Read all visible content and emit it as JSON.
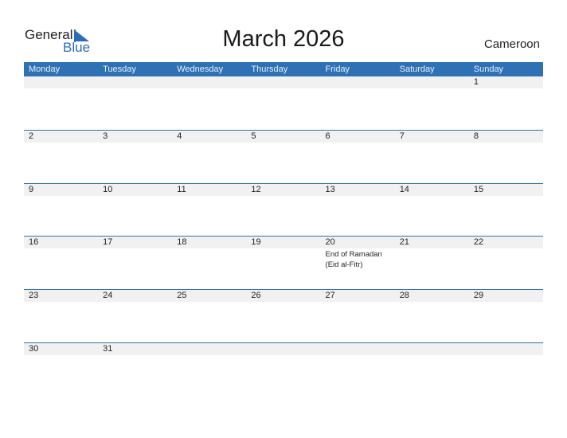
{
  "logo": {
    "text_general": "General",
    "text_blue": "Blue"
  },
  "title": "March 2026",
  "country": "Cameroon",
  "colors": {
    "accent": "#2e72b5",
    "shade": "#f1f1f1"
  },
  "weekdays": [
    "Monday",
    "Tuesday",
    "Wednesday",
    "Thursday",
    "Friday",
    "Saturday",
    "Sunday"
  ],
  "weeks": [
    [
      "",
      "",
      "",
      "",
      "",
      "",
      "1"
    ],
    [
      "2",
      "3",
      "4",
      "5",
      "6",
      "7",
      "8"
    ],
    [
      "9",
      "10",
      "11",
      "12",
      "13",
      "14",
      "15"
    ],
    [
      "16",
      "17",
      "18",
      "19",
      "20",
      "21",
      "22"
    ],
    [
      "23",
      "24",
      "25",
      "26",
      "27",
      "28",
      "29"
    ],
    [
      "30",
      "31",
      "",
      "",
      "",
      "",
      ""
    ]
  ],
  "events": [
    {
      "week": 3,
      "day": 4,
      "label": "End of Ramadan (Eid al-Fitr)"
    }
  ]
}
